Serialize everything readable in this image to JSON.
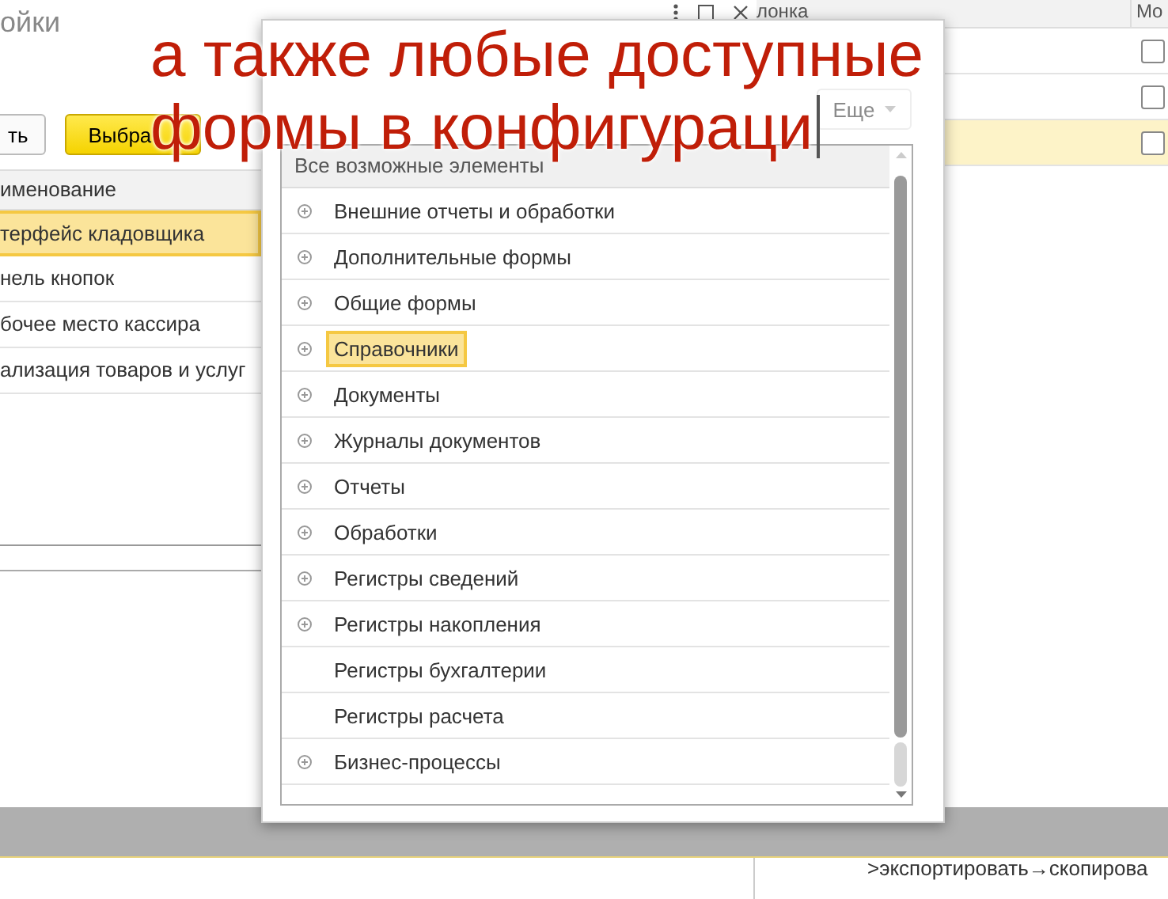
{
  "back_window": {
    "title": "ойки",
    "buttons": [
      {
        "label": "ть",
        "kind": "plain"
      },
      {
        "label": "Выбра",
        "kind": "default"
      }
    ],
    "table": {
      "column": "именование",
      "rows": [
        {
          "text": "терфейс кладовщика",
          "selected": true
        },
        {
          "text": "нель кнопок",
          "selected": false
        },
        {
          "text": "бочее место кассира",
          "selected": false
        },
        {
          "text": "ализация товаров и услуг",
          "selected": false
        }
      ]
    }
  },
  "right_table": {
    "columns": [
      "лонка",
      "Mo"
    ],
    "rows": [
      {
        "checked": false,
        "selected": false
      },
      {
        "checked": false,
        "selected": false
      },
      {
        "checked": false,
        "selected": true
      }
    ]
  },
  "dialog": {
    "more_button": "Еще",
    "list": {
      "header": "Все возможные элементы",
      "items": [
        {
          "label": "Внешние отчеты и обработки",
          "expandable": true,
          "selected": false
        },
        {
          "label": "Дополнительные формы",
          "expandable": true,
          "selected": false
        },
        {
          "label": "Общие формы",
          "expandable": true,
          "selected": false
        },
        {
          "label": "Справочники",
          "expandable": true,
          "selected": true
        },
        {
          "label": "Документы",
          "expandable": true,
          "selected": false
        },
        {
          "label": "Журналы документов",
          "expandable": true,
          "selected": false
        },
        {
          "label": "Отчеты",
          "expandable": true,
          "selected": false
        },
        {
          "label": "Обработки",
          "expandable": true,
          "selected": false
        },
        {
          "label": "Регистры сведений",
          "expandable": true,
          "selected": false
        },
        {
          "label": "Регистры накопления",
          "expandable": true,
          "selected": false
        },
        {
          "label": "Регистры бухгалтерии",
          "expandable": false,
          "selected": false
        },
        {
          "label": "Регистры расчета",
          "expandable": false,
          "selected": false
        },
        {
          "label": "Бизнес-процессы",
          "expandable": true,
          "selected": false
        }
      ]
    }
  },
  "annotation": {
    "lines": [
      "а также любые доступные",
      "формы в конфигураци"
    ]
  },
  "bottom_text": ">экспортировать→скопирова"
}
